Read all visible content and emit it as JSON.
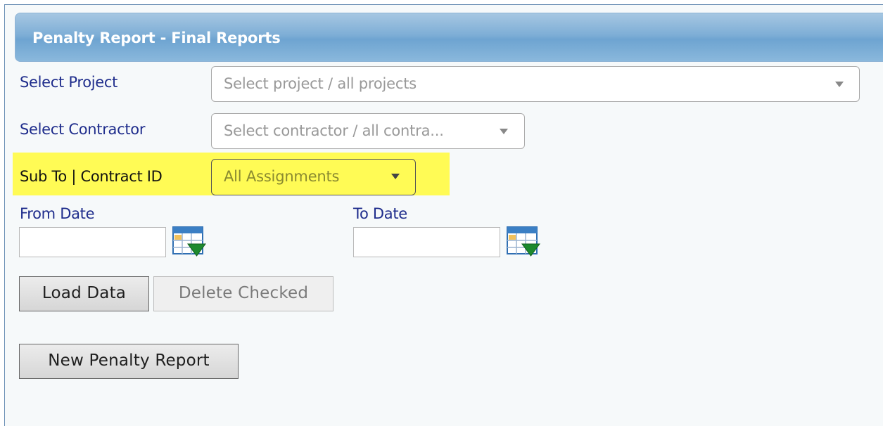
{
  "header": {
    "title": "Penalty Report - Final Reports"
  },
  "filters": {
    "project": {
      "label": "Select Project",
      "placeholder": "Select project / all projects"
    },
    "contractor": {
      "label": "Select Contractor",
      "placeholder": "Select contractor / all contra..."
    },
    "assignment": {
      "label": "Sub To | Contract ID",
      "value": "All Assignments",
      "highlight_color": "#fffb55"
    },
    "from_date": {
      "label": "From Date",
      "value": ""
    },
    "to_date": {
      "label": "To Date",
      "value": ""
    }
  },
  "buttons": {
    "load_data": "Load Data",
    "delete_checked": "Delete Checked",
    "new_penalty_report": "New Penalty Report"
  },
  "colors": {
    "label_text": "#1f2d8c",
    "header_accent": "#7eaed6"
  }
}
